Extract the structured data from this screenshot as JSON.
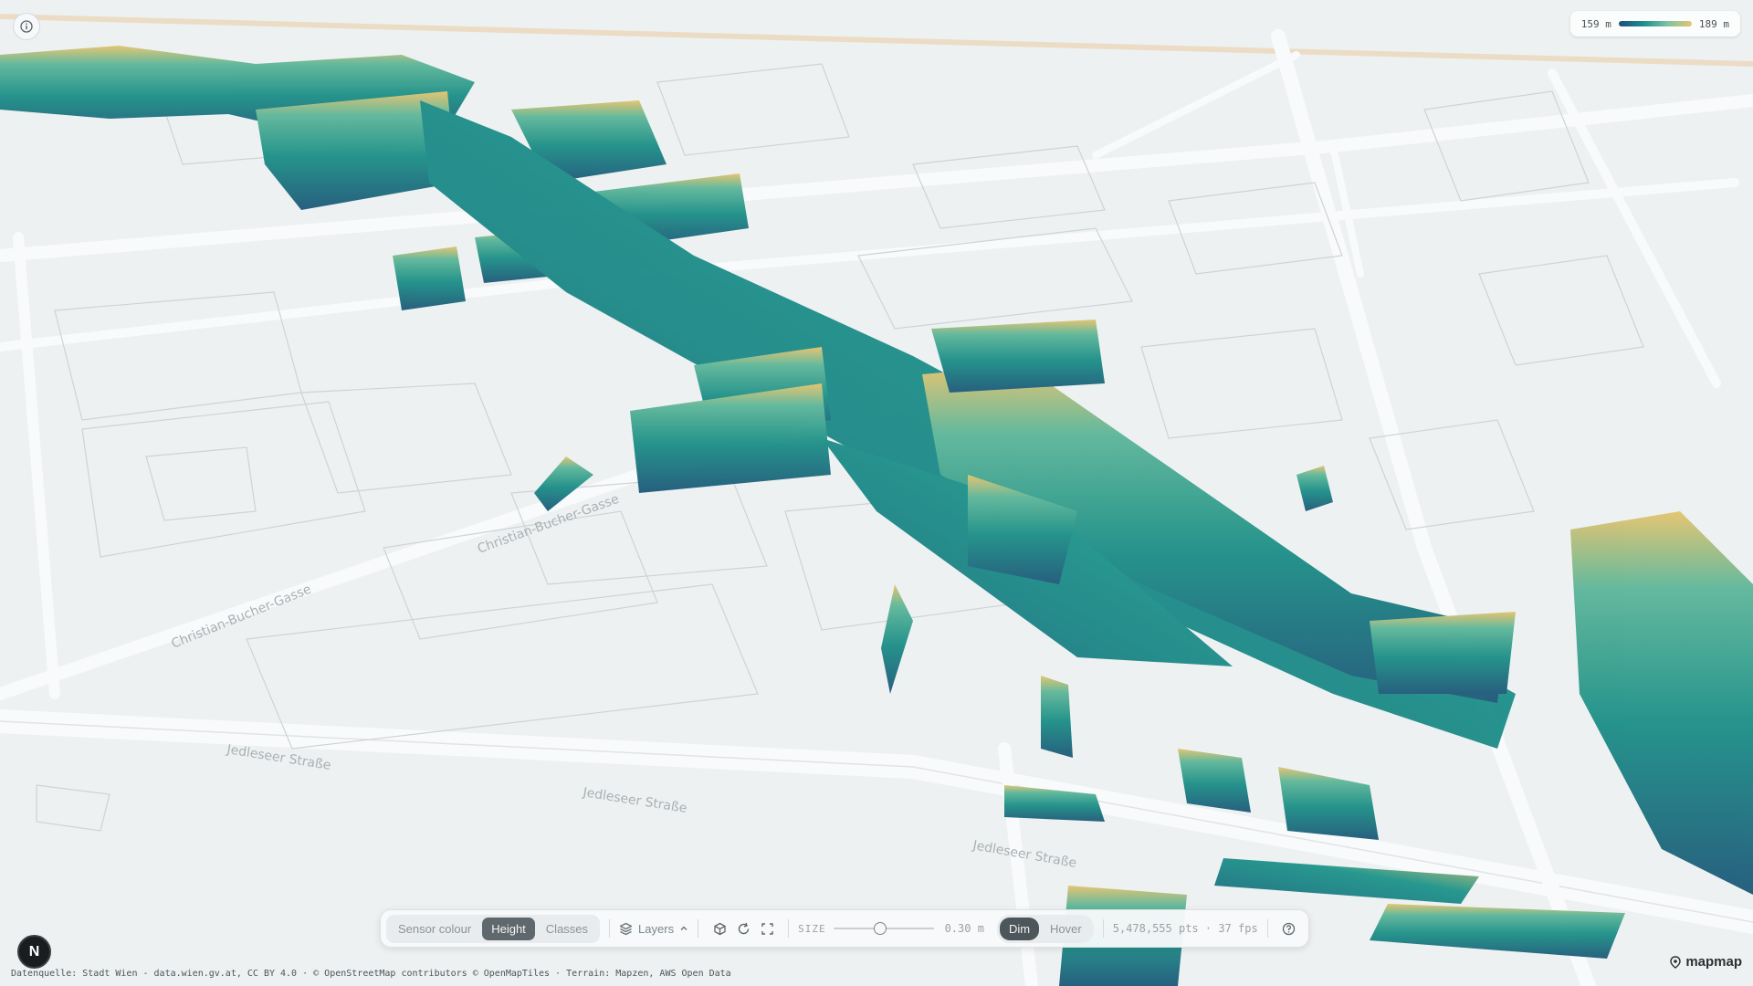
{
  "info_button": {
    "icon": "info-icon"
  },
  "legend": {
    "min_label": "159 m",
    "max_label": "189 m",
    "gradient_colors": [
      "#1f4f78",
      "#1d8d8d",
      "#7cc3a4",
      "#e7c471"
    ]
  },
  "map": {
    "street_labels": [
      "Christian-Bucher-Gasse",
      "Christian-Bucher-Gasse",
      "Jedleseer Straße",
      "Jedleseer Straße",
      "Jedleseer Straße"
    ],
    "pointcloud_colors": {
      "low": "#1f5a7a",
      "mid": "#1e9088",
      "high": "#e4c46e"
    }
  },
  "toolbar": {
    "color_modes": [
      "Sensor colour",
      "Height",
      "Classes"
    ],
    "active_color_mode": "Height",
    "layers_label": "Layers",
    "size_label": "SIZE",
    "size_value": "0.30 m",
    "size_fraction": 0.45,
    "dim_label": "Dim",
    "hover_label": "Hover",
    "stats": "5,478,555 pts · 37 fps"
  },
  "avatar_letter": "N",
  "attribution": "Datenquelle: Stadt Wien - data.wien.gv.at, CC BY 4.0 · © OpenStreetMap contributors © OpenMapTiles · Terrain: Mapzen, AWS Open Data",
  "brand": "mapmap"
}
